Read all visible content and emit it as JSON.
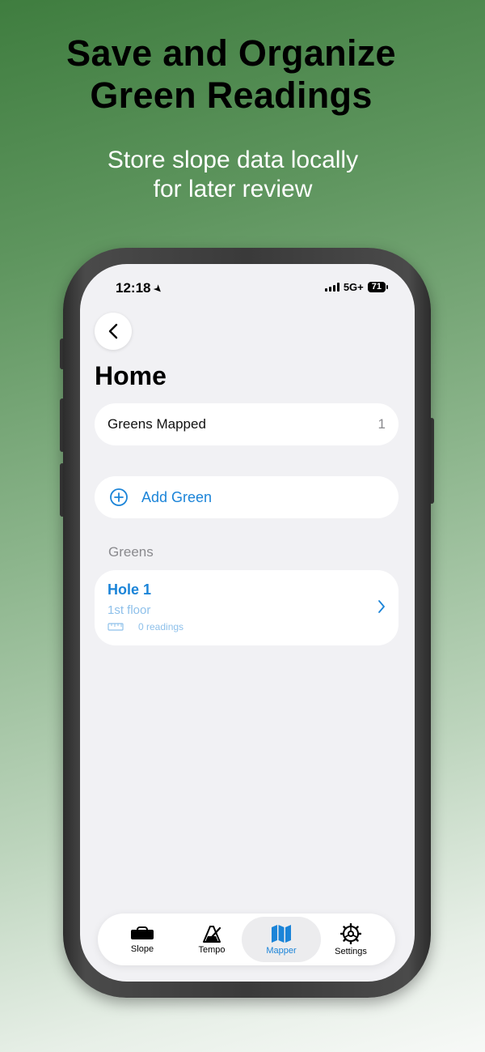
{
  "promo": {
    "headline_line1": "Save and Organize",
    "headline_line2": "Green Readings",
    "subhead_line1": "Store slope data locally",
    "subhead_line2": "for later review"
  },
  "status_bar": {
    "time": "12:18",
    "network": "5G+",
    "battery": "71"
  },
  "header": {
    "title": "Home"
  },
  "summary": {
    "label": "Greens Mapped",
    "count": "1"
  },
  "add_green": {
    "label": "Add Green"
  },
  "greens_section": {
    "label": "Greens",
    "items": [
      {
        "name": "Hole 1",
        "floor": "1st floor",
        "readings": "0 readings"
      }
    ]
  },
  "tabs": [
    {
      "label": "Slope",
      "icon": "level-icon"
    },
    {
      "label": "Tempo",
      "icon": "metronome-icon"
    },
    {
      "label": "Mapper",
      "icon": "map-icon"
    },
    {
      "label": "Settings",
      "icon": "gear-icon"
    }
  ],
  "colors": {
    "accent": "#1b84d8",
    "background_top": "#3f7d3f",
    "screen_bg": "#f1f1f4"
  }
}
